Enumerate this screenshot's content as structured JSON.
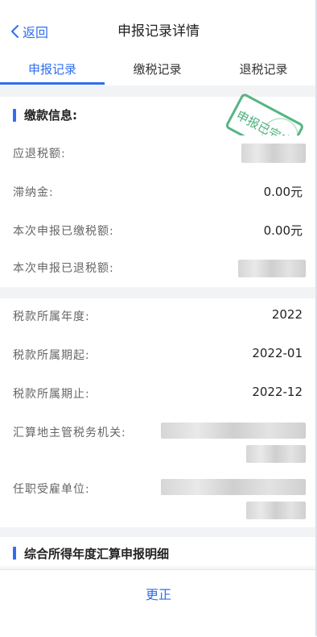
{
  "nav": {
    "back_label": "返回",
    "title": "申报记录详情"
  },
  "tabs": [
    {
      "label": "申报记录",
      "active": true
    },
    {
      "label": "缴税记录",
      "active": false
    },
    {
      "label": "退税记录",
      "active": false
    }
  ],
  "payment_section": {
    "title": "缴款信息:",
    "stamp_text": "申报已完成",
    "rows": [
      {
        "label": "应退税额:",
        "value": ""
      },
      {
        "label": "滞纳金:",
        "value": "0.00元"
      },
      {
        "label": "本次申报已缴税额:",
        "value": "0.00元"
      },
      {
        "label": "本次申报已退税额:",
        "value": ""
      }
    ]
  },
  "tax_info": {
    "rows": [
      {
        "label": "税款所属年度:",
        "value": "2022"
      },
      {
        "label": "税款所属期起:",
        "value": "2022-01"
      },
      {
        "label": "税款所属期止:",
        "value": "2022-12"
      },
      {
        "label": "汇算地主管税务机关:",
        "value": ""
      },
      {
        "label": "任职受雇单位:",
        "value": ""
      }
    ]
  },
  "detail_section": {
    "title": "综合所得年度汇算申报明细"
  },
  "footer": {
    "correct_label": "更正"
  },
  "colors": {
    "accent": "#2f6ff0",
    "stamp": "#3aa76d",
    "background_gap": "#f2f3f5"
  }
}
